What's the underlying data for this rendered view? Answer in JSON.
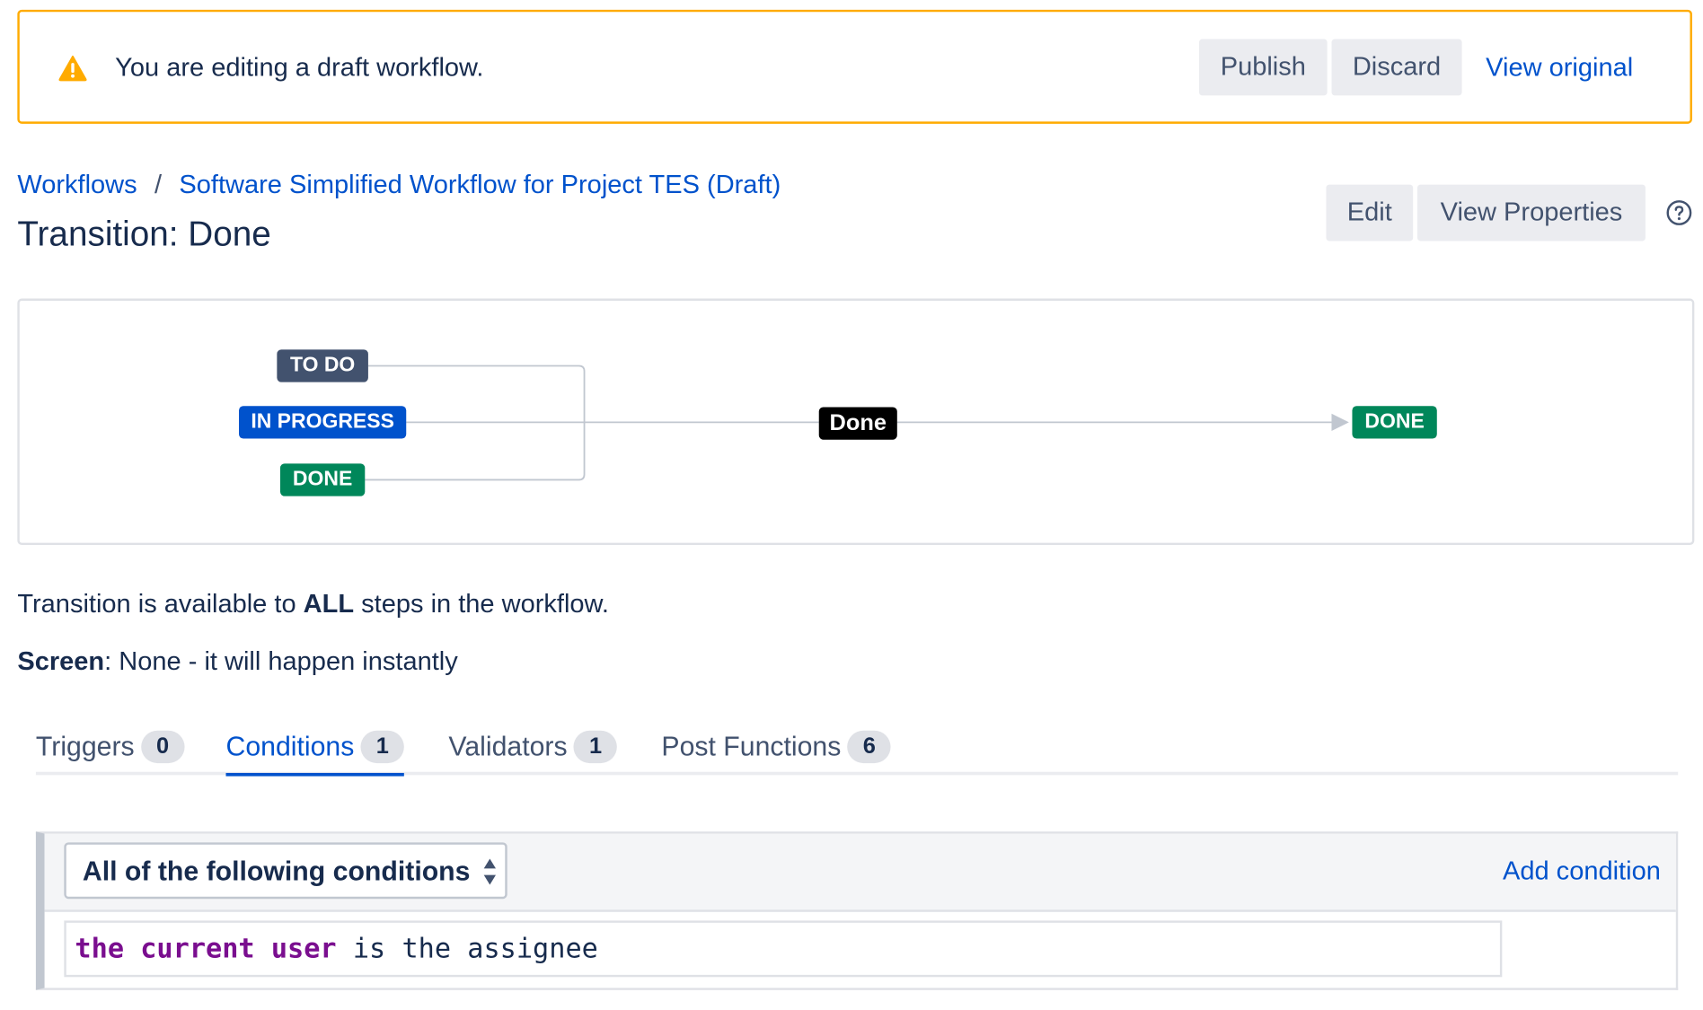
{
  "banner": {
    "message": "You are editing a draft workflow.",
    "publish_label": "Publish",
    "discard_label": "Discard",
    "view_original_label": "View original"
  },
  "breadcrumb": {
    "root": "Workflows",
    "separator": "/",
    "current": "Software Simplified Workflow for Project TES (Draft)"
  },
  "title": "Transition: Done",
  "header_actions": {
    "edit_label": "Edit",
    "view_properties_label": "View Properties",
    "help_icon": "question-circle-icon"
  },
  "diagram": {
    "source_statuses": [
      {
        "label": "TO DO",
        "color": "#42526e"
      },
      {
        "label": "IN PROGRESS",
        "color": "#0052cc"
      },
      {
        "label": "DONE",
        "color": "#00875a"
      }
    ],
    "transition_label": "Done",
    "target_status": {
      "label": "DONE",
      "color": "#00875a"
    }
  },
  "info": {
    "available_prefix": "Transition is available to ",
    "available_bold": "ALL",
    "available_suffix": " steps in the workflow.",
    "screen_label": "Screen",
    "screen_value": ": None - it will happen instantly"
  },
  "tabs": [
    {
      "label": "Triggers",
      "count": "0",
      "active": false
    },
    {
      "label": "Conditions",
      "count": "1",
      "active": true
    },
    {
      "label": "Validators",
      "count": "1",
      "active": false
    },
    {
      "label": "Post Functions",
      "count": "6",
      "active": false
    }
  ],
  "conditions": {
    "mode_selected": "All of the following conditions",
    "add_label": "Add condition",
    "items": [
      {
        "keyword": "the current user",
        "rest": " is the assignee"
      }
    ]
  },
  "colors": {
    "accent": "#0052cc",
    "warning": "#ffab00",
    "done_green": "#00875a"
  }
}
